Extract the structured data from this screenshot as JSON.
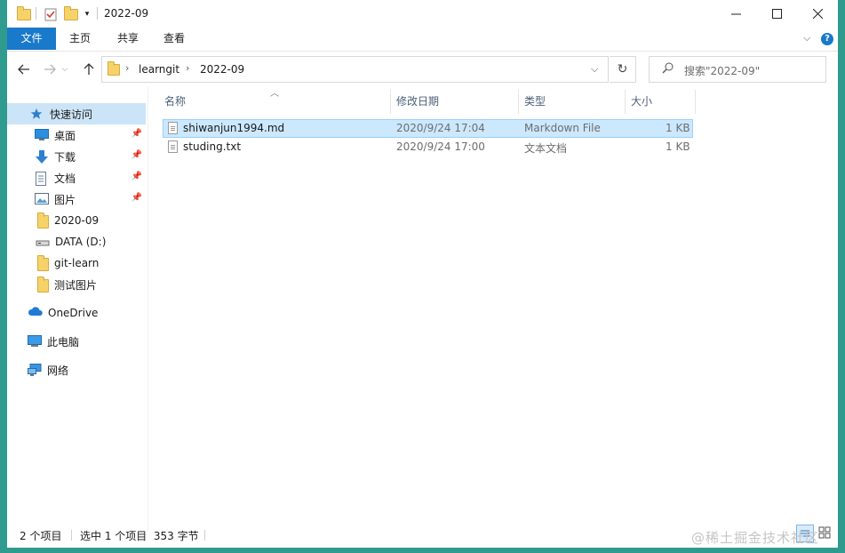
{
  "titlebar": {
    "title": "2022-09",
    "minimize_icon": "minimize-icon",
    "maximize_icon": "maximize-icon",
    "close_icon": "close-icon"
  },
  "ribbon": {
    "tabs": [
      "文件",
      "主页",
      "共享",
      "查看"
    ],
    "help": "?"
  },
  "address": {
    "crumbs": [
      "learngit",
      "2022-09"
    ],
    "search_placeholder": "搜索\"2022-09\""
  },
  "sidebar": {
    "items": [
      {
        "label": "快速访问",
        "icon": "star-icon"
      },
      {
        "label": "桌面",
        "icon": "desktop-icon",
        "pinned": true
      },
      {
        "label": "下载",
        "icon": "download-icon",
        "pinned": true
      },
      {
        "label": "文档",
        "icon": "document-icon",
        "pinned": true
      },
      {
        "label": "图片",
        "icon": "picture-icon",
        "pinned": true
      },
      {
        "label": "2020-09",
        "icon": "folder-icon"
      },
      {
        "label": "DATA (D:)",
        "icon": "drive-icon"
      },
      {
        "label": "git-learn",
        "icon": "folder-icon"
      },
      {
        "label": "测试图片",
        "icon": "folder-icon"
      },
      {
        "label": "OneDrive",
        "icon": "cloud-icon"
      },
      {
        "label": "此电脑",
        "icon": "computer-icon"
      },
      {
        "label": "网络",
        "icon": "network-icon"
      }
    ]
  },
  "list": {
    "columns": [
      "名称",
      "修改日期",
      "类型",
      "大小"
    ],
    "rows": [
      {
        "name": "shiwanjun1994.md",
        "date": "2020/9/24 17:04",
        "type": "Markdown File",
        "size": "1 KB",
        "selected": true
      },
      {
        "name": "studing.txt",
        "date": "2020/9/24 17:00",
        "type": "文本文档",
        "size": "1 KB",
        "selected": false
      }
    ]
  },
  "status": {
    "count": "2 个项目",
    "selection": "选中 1 个项目  353 字节"
  },
  "watermark": "@稀土掘金技术社区",
  "colors": {
    "accent": "#1979ca",
    "selection": "#cce8ff",
    "folder": "#f6d26a"
  }
}
